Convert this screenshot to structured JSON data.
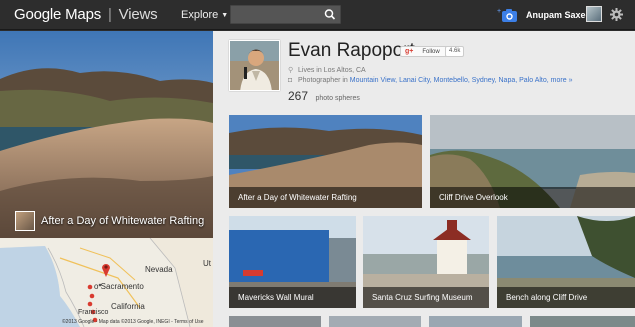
{
  "header": {
    "logo_google": "Google",
    "logo_maps": "Maps",
    "logo_sep": "|",
    "logo_views": "Views",
    "explore_label": "Explore",
    "search_placeholder": "",
    "user_name": "Anupam Saxena"
  },
  "hero": {
    "caption": "After a Day of Whitewater Rafting"
  },
  "map": {
    "labels": {
      "nevada": "Nevada",
      "sacramento": "Sacramento",
      "california": "California",
      "francisco": "Francisco",
      "utah": "Ut"
    },
    "footer": "©2013 Google - Map data ©2013 Google, INEGI - Terms of Use"
  },
  "profile": {
    "name": "Evan Rapoport",
    "follow_label": "Follow",
    "follow_count": "4.6k",
    "location": "Lives in Los Altos, CA",
    "photographer_prefix": "Photographer in",
    "places": [
      "Mountain View,",
      "Lanai City,",
      "Montebello,",
      "Sydney,",
      "Napa,",
      "Palo Alto,",
      "more »"
    ],
    "sphere_count": "267",
    "sphere_label": "photo spheres"
  },
  "tiles": [
    {
      "caption": "After a Day of Whitewater Rafting"
    },
    {
      "caption": "Cliff Drive Overlook"
    },
    {
      "caption": "Mavericks Wall Mural"
    },
    {
      "caption": "Santa Cruz Surfing Museum"
    },
    {
      "caption": "Bench along Cliff Drive"
    }
  ],
  "colors": {
    "accent": "#3a72c9",
    "topbar": "#2d2d2d",
    "content_bg": "#ebebeb",
    "selected_outline": "#4a90e2",
    "map_pin": "#d93b30"
  }
}
